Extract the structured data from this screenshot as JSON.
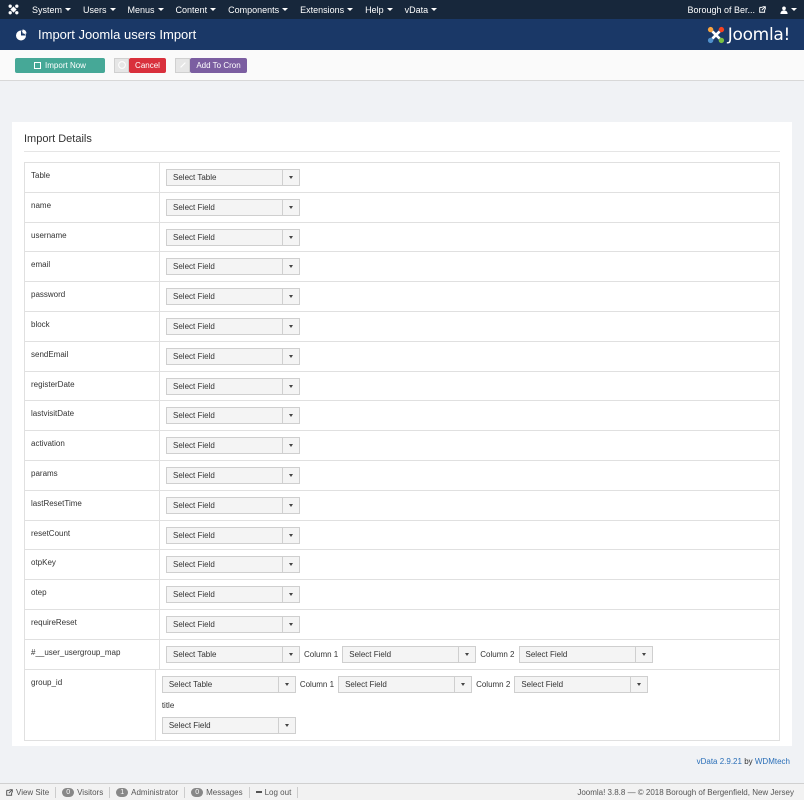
{
  "nav": {
    "items": [
      {
        "label": "System",
        "caret": true
      },
      {
        "label": "Users",
        "caret": true
      },
      {
        "label": "Menus",
        "caret": true
      },
      {
        "label": "Content",
        "caret": true
      },
      {
        "label": "Components",
        "caret": true
      },
      {
        "label": "Extensions",
        "caret": true
      },
      {
        "label": "Help",
        "caret": true
      },
      {
        "label": "vData",
        "caret": true
      }
    ],
    "site_name": "Borough of Ber...",
    "user_icon": "user-icon"
  },
  "header": {
    "title": "Import Joomla users Import",
    "brand": "Joomla!"
  },
  "toolbar": {
    "import_label": "Import Now",
    "cancel_label": "Cancel",
    "cron_label": "Add To Cron"
  },
  "panel": {
    "title": "Import Details",
    "rows": [
      {
        "label": "Table",
        "select": "Select Table"
      },
      {
        "label": "name",
        "select": "Select Field"
      },
      {
        "label": "username",
        "select": "Select Field"
      },
      {
        "label": "email",
        "select": "Select Field"
      },
      {
        "label": "password",
        "select": "Select Field"
      },
      {
        "label": "block",
        "select": "Select Field"
      },
      {
        "label": "sendEmail",
        "select": "Select Field"
      },
      {
        "label": "registerDate",
        "select": "Select Field"
      },
      {
        "label": "lastvisitDate",
        "select": "Select Field"
      },
      {
        "label": "activation",
        "select": "Select Field"
      },
      {
        "label": "params",
        "select": "Select Field"
      },
      {
        "label": "lastResetTime",
        "select": "Select Field"
      },
      {
        "label": "resetCount",
        "select": "Select Field"
      },
      {
        "label": "otpKey",
        "select": "Select Field"
      },
      {
        "label": "otep",
        "select": "Select Field"
      },
      {
        "label": "requireReset",
        "select": "Select Field"
      }
    ],
    "map_row": {
      "label": "#__user_usergroup_map",
      "table_select": "Select Table",
      "col1_label": "Column 1",
      "col1_select": "Select Field",
      "col2_label": "Column 2",
      "col2_select": "Select Field"
    },
    "group_row": {
      "label": "group_id",
      "table_select": "Select Table",
      "col1_label": "Column 1",
      "col1_select": "Select Field",
      "col2_label": "Column 2",
      "col2_select": "Select Field",
      "title_label": "title",
      "title_select": "Select Field"
    }
  },
  "version": {
    "text": "vData 2.9.21",
    "by": " by ",
    "author": "WDMtech"
  },
  "statusbar": {
    "view_site": "View Site",
    "visitors_count": "0",
    "visitors_label": "Visitors",
    "admin_count": "1",
    "admin_label": "Administrator",
    "messages_count": "0",
    "messages_label": "Messages",
    "logout": "Log out",
    "copyright": "Joomla! 3.8.8 — © 2018 Borough of Bergenfield, New Jersey"
  }
}
